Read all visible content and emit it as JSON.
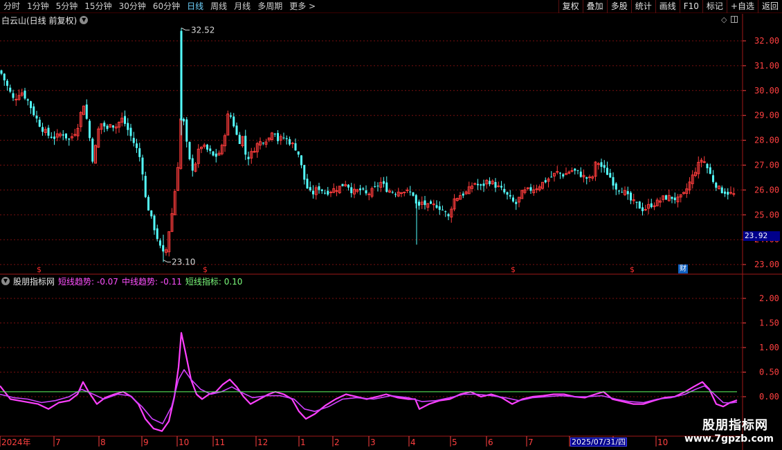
{
  "toolbar": {
    "periods": [
      "分时",
      "1分钟",
      "5分钟",
      "15分钟",
      "30分钟",
      "60分钟",
      "日线",
      "周线",
      "月线",
      "多周期",
      "更多 >"
    ],
    "active_period": "日线",
    "tools": [
      "复权",
      "叠加",
      "多股",
      "统计",
      "画线",
      "F10",
      "标记",
      "+自选",
      "返回"
    ]
  },
  "main_panel": {
    "title": "白云山(日线 前复权)",
    "high_label": "32.52",
    "low_label": "23.10",
    "last_price_tag": "23.92",
    "cai_marker": "财",
    "dividend_marker": "$"
  },
  "indicator_panel": {
    "name": "股朋指标网",
    "short_trend_label": "短线趋势: -0.07",
    "mid_trend_label": "中线趋势: -0.11",
    "short_indicator_label": "短线指标: 0.10"
  },
  "date_tag": "2025/07/31/四",
  "watermark": {
    "title": "股朋指标网",
    "url": "www.7gpzb.com"
  },
  "colors": {
    "up": "#ff3c3c",
    "down": "#54ffff",
    "short_trend": "#ff40ff",
    "mid_trend": "#d040ff",
    "short_indicator": "#60ff60",
    "axis": "#ff4040",
    "grid": "#7a1010"
  },
  "chart_data": [
    {
      "type": "candlestick",
      "title": "白云山(日线 前复权)",
      "ylim": [
        22.8,
        33.0
      ],
      "yticks": [
        "32.00",
        "31.00",
        "30.00",
        "29.00",
        "28.00",
        "27.00",
        "26.00",
        "25.00",
        "24.00",
        "23.00"
      ],
      "xticks": [
        "2024年",
        "7",
        "8",
        "9",
        "10",
        "11",
        "12",
        "1",
        "2",
        "3",
        "4",
        "5",
        "6",
        "7",
        "8",
        "9",
        "10"
      ],
      "close_path": [
        [
          0,
          30.8
        ],
        [
          10,
          30.2
        ],
        [
          20,
          29.6
        ],
        [
          30,
          30.0
        ],
        [
          40,
          29.6
        ],
        [
          50,
          29.0
        ],
        [
          60,
          28.5
        ],
        [
          70,
          28.2
        ],
        [
          80,
          28.1
        ],
        [
          90,
          28.3
        ],
        [
          100,
          28.0
        ],
        [
          110,
          28.4
        ],
        [
          115,
          28.8
        ],
        [
          120,
          29.6
        ],
        [
          125,
          28.9
        ],
        [
          130,
          28.0
        ],
        [
          135,
          27.0
        ],
        [
          140,
          28.2
        ],
        [
          145,
          28.7
        ],
        [
          150,
          28.6
        ],
        [
          155,
          28.4
        ],
        [
          160,
          28.8
        ],
        [
          165,
          28.5
        ],
        [
          170,
          28.6
        ],
        [
          175,
          28.9
        ],
        [
          180,
          28.7
        ],
        [
          185,
          28.4
        ],
        [
          190,
          28.1
        ],
        [
          195,
          27.8
        ],
        [
          200,
          27.5
        ],
        [
          205,
          27.0
        ],
        [
          210,
          25.7
        ],
        [
          215,
          25.2
        ],
        [
          220,
          24.7
        ],
        [
          225,
          24.3
        ],
        [
          230,
          23.8
        ],
        [
          235,
          23.4
        ],
        [
          240,
          23.6
        ],
        [
          245,
          24.5
        ],
        [
          250,
          25.3
        ],
        [
          255,
          26.5
        ],
        [
          259,
          27.5
        ],
        [
          262,
          29.3
        ],
        [
          265,
          28.8
        ],
        [
          270,
          27.8
        ],
        [
          275,
          27.0
        ],
        [
          280,
          26.8
        ],
        [
          285,
          27.4
        ],
        [
          290,
          27.8
        ],
        [
          300,
          27.6
        ],
        [
          310,
          27.3
        ],
        [
          320,
          27.6
        ],
        [
          325,
          28.3
        ],
        [
          330,
          29.1
        ],
        [
          335,
          28.9
        ],
        [
          340,
          28.4
        ],
        [
          345,
          27.9
        ],
        [
          350,
          28.2
        ],
        [
          355,
          27.4
        ],
        [
          360,
          27.3
        ],
        [
          370,
          27.8
        ],
        [
          380,
          28.0
        ],
        [
          390,
          28.1
        ],
        [
          395,
          28.6
        ],
        [
          400,
          28.0
        ],
        [
          410,
          28.1
        ],
        [
          420,
          27.9
        ],
        [
          430,
          27.6
        ],
        [
          435,
          27.0
        ],
        [
          440,
          26.4
        ],
        [
          445,
          26.0
        ],
        [
          450,
          25.8
        ],
        [
          460,
          26.1
        ],
        [
          470,
          25.9
        ],
        [
          480,
          26.0
        ],
        [
          490,
          26.1
        ],
        [
          500,
          26.3
        ],
        [
          510,
          25.9
        ],
        [
          520,
          26.0
        ],
        [
          530,
          25.8
        ],
        [
          540,
          26.0
        ],
        [
          550,
          26.3
        ],
        [
          560,
          26.0
        ],
        [
          570,
          25.9
        ],
        [
          580,
          26.0
        ],
        [
          590,
          25.9
        ],
        [
          600,
          25.8
        ],
        [
          603,
          24.9
        ],
        [
          606,
          25.4
        ],
        [
          610,
          25.5
        ],
        [
          620,
          25.3
        ],
        [
          630,
          25.4
        ],
        [
          640,
          25.2
        ],
        [
          648,
          24.9
        ],
        [
          655,
          25.6
        ],
        [
          665,
          25.8
        ],
        [
          675,
          25.9
        ],
        [
          685,
          26.3
        ],
        [
          695,
          26.1
        ],
        [
          705,
          26.4
        ],
        [
          715,
          26.2
        ],
        [
          725,
          26.0
        ],
        [
          735,
          25.7
        ],
        [
          745,
          25.4
        ],
        [
          755,
          25.9
        ],
        [
          765,
          26.0
        ],
        [
          775,
          26.1
        ],
        [
          785,
          26.3
        ],
        [
          795,
          26.5
        ],
        [
          805,
          26.7
        ],
        [
          815,
          26.6
        ],
        [
          825,
          26.8
        ],
        [
          835,
          26.7
        ],
        [
          845,
          26.5
        ],
        [
          855,
          26.4
        ],
        [
          862,
          27.2
        ],
        [
          870,
          26.9
        ],
        [
          880,
          26.6
        ],
        [
          890,
          26.1
        ],
        [
          900,
          26.0
        ],
        [
          910,
          25.6
        ],
        [
          920,
          25.4
        ],
        [
          930,
          25.2
        ],
        [
          940,
          25.4
        ],
        [
          950,
          25.5
        ],
        [
          960,
          25.7
        ],
        [
          970,
          25.7
        ],
        [
          980,
          25.6
        ],
        [
          988,
          25.8
        ],
        [
          995,
          26.2
        ],
        [
          1005,
          26.8
        ],
        [
          1015,
          27.3
        ],
        [
          1020,
          27.0
        ],
        [
          1030,
          26.4
        ],
        [
          1040,
          26.0
        ],
        [
          1050,
          25.9
        ],
        [
          1062,
          25.8
        ]
      ]
    },
    {
      "type": "line",
      "ylim": [
        -0.75,
        2.35
      ],
      "yticks": [
        "2.00",
        "1.50",
        "1.00",
        "0.50",
        "0.00"
      ],
      "series": [
        {
          "name": "短线趋势",
          "points": [
            [
              0,
              0.22
            ],
            [
              15,
              -0.05
            ],
            [
              35,
              -0.1
            ],
            [
              55,
              -0.15
            ],
            [
              70,
              -0.25
            ],
            [
              85,
              -0.12
            ],
            [
              100,
              -0.08
            ],
            [
              112,
              0.05
            ],
            [
              120,
              0.3
            ],
            [
              128,
              0.1
            ],
            [
              140,
              -0.15
            ],
            [
              152,
              -0.02
            ],
            [
              165,
              0.05
            ],
            [
              178,
              0.1
            ],
            [
              190,
              0.0
            ],
            [
              200,
              -0.15
            ],
            [
              210,
              -0.45
            ],
            [
              222,
              -0.65
            ],
            [
              234,
              -0.7
            ],
            [
              244,
              -0.5
            ],
            [
              252,
              0.0
            ],
            [
              258,
              0.6
            ],
            [
              262,
              1.3
            ],
            [
              268,
              0.9
            ],
            [
              276,
              0.35
            ],
            [
              284,
              0.05
            ],
            [
              292,
              -0.05
            ],
            [
              302,
              0.05
            ],
            [
              312,
              0.1
            ],
            [
              322,
              0.25
            ],
            [
              332,
              0.35
            ],
            [
              342,
              0.2
            ],
            [
              352,
              0.0
            ],
            [
              362,
              -0.15
            ],
            [
              375,
              -0.05
            ],
            [
              388,
              0.05
            ],
            [
              398,
              0.1
            ],
            [
              410,
              0.05
            ],
            [
              422,
              -0.05
            ],
            [
              432,
              -0.3
            ],
            [
              442,
              -0.45
            ],
            [
              455,
              -0.35
            ],
            [
              470,
              -0.18
            ],
            [
              485,
              -0.05
            ],
            [
              500,
              0.05
            ],
            [
              515,
              0.0
            ],
            [
              530,
              -0.05
            ],
            [
              545,
              0.0
            ],
            [
              558,
              0.05
            ],
            [
              575,
              -0.02
            ],
            [
              590,
              -0.05
            ],
            [
              600,
              -0.05
            ],
            [
              606,
              -0.25
            ],
            [
              620,
              -0.15
            ],
            [
              635,
              -0.08
            ],
            [
              650,
              -0.05
            ],
            [
              665,
              0.05
            ],
            [
              680,
              0.1
            ],
            [
              695,
              0.0
            ],
            [
              710,
              0.05
            ],
            [
              725,
              -0.02
            ],
            [
              740,
              -0.15
            ],
            [
              755,
              -0.05
            ],
            [
              770,
              0.0
            ],
            [
              785,
              0.02
            ],
            [
              800,
              0.05
            ],
            [
              815,
              0.05
            ],
            [
              830,
              0.0
            ],
            [
              845,
              -0.02
            ],
            [
              860,
              0.05
            ],
            [
              872,
              0.1
            ],
            [
              885,
              -0.05
            ],
            [
              900,
              -0.1
            ],
            [
              915,
              -0.15
            ],
            [
              930,
              -0.15
            ],
            [
              945,
              -0.08
            ],
            [
              960,
              -0.02
            ],
            [
              975,
              0.0
            ],
            [
              990,
              0.1
            ],
            [
              1002,
              0.2
            ],
            [
              1015,
              0.3
            ],
            [
              1025,
              0.15
            ],
            [
              1035,
              -0.15
            ],
            [
              1045,
              -0.2
            ],
            [
              1055,
              -0.12
            ],
            [
              1065,
              -0.07
            ]
          ]
        },
        {
          "name": "中线趋势",
          "points": [
            [
              0,
              0.05
            ],
            [
              20,
              -0.02
            ],
            [
              40,
              -0.05
            ],
            [
              60,
              -0.12
            ],
            [
              80,
              -0.08
            ],
            [
              100,
              0.0
            ],
            [
              118,
              0.15
            ],
            [
              135,
              0.05
            ],
            [
              150,
              -0.05
            ],
            [
              170,
              0.05
            ],
            [
              188,
              0.02
            ],
            [
              205,
              -0.2
            ],
            [
              220,
              -0.45
            ],
            [
              235,
              -0.55
            ],
            [
              248,
              -0.2
            ],
            [
              258,
              0.35
            ],
            [
              266,
              0.55
            ],
            [
              276,
              0.35
            ],
            [
              290,
              0.15
            ],
            [
              305,
              0.05
            ],
            [
              320,
              0.1
            ],
            [
              335,
              0.2
            ],
            [
              350,
              0.08
            ],
            [
              365,
              -0.02
            ],
            [
              385,
              0.02
            ],
            [
              405,
              0.02
            ],
            [
              425,
              -0.05
            ],
            [
              440,
              -0.25
            ],
            [
              455,
              -0.3
            ],
            [
              475,
              -0.2
            ],
            [
              495,
              -0.05
            ],
            [
              515,
              -0.02
            ],
            [
              540,
              -0.05
            ],
            [
              565,
              0.02
            ],
            [
              590,
              -0.02
            ],
            [
              610,
              -0.1
            ],
            [
              630,
              -0.08
            ],
            [
              650,
              -0.02
            ],
            [
              670,
              0.05
            ],
            [
              690,
              0.05
            ],
            [
              710,
              0.02
            ],
            [
              730,
              -0.02
            ],
            [
              750,
              -0.08
            ],
            [
              770,
              -0.02
            ],
            [
              790,
              0.0
            ],
            [
              810,
              0.02
            ],
            [
              830,
              0.0
            ],
            [
              850,
              0.0
            ],
            [
              870,
              0.02
            ],
            [
              890,
              -0.05
            ],
            [
              910,
              -0.1
            ],
            [
              930,
              -0.12
            ],
            [
              950,
              -0.05
            ],
            [
              970,
              -0.02
            ],
            [
              990,
              0.05
            ],
            [
              1005,
              0.15
            ],
            [
              1018,
              0.22
            ],
            [
              1030,
              0.08
            ],
            [
              1045,
              -0.12
            ],
            [
              1055,
              -0.13
            ],
            [
              1065,
              -0.11
            ]
          ]
        },
        {
          "name": "短线指标",
          "points": [
            [
              0,
              0.1
            ],
            [
              1065,
              0.1
            ]
          ]
        }
      ]
    }
  ]
}
